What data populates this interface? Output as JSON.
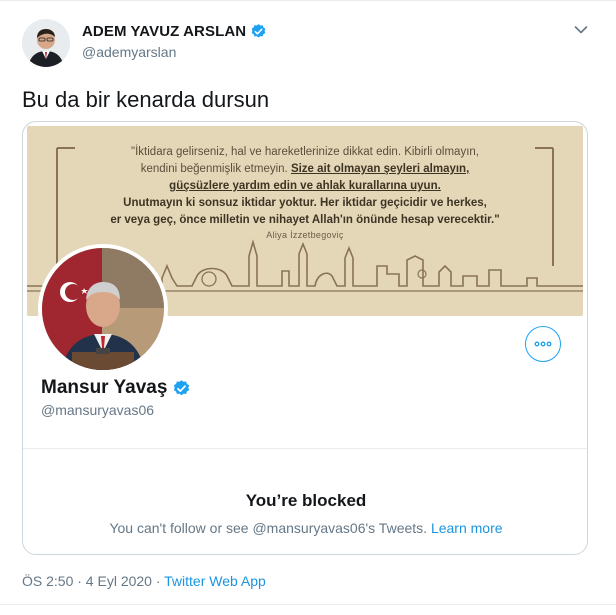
{
  "author": {
    "name": "ADEM YAVUZ ARSLAN",
    "handle": "@ademyarslan",
    "verified": true
  },
  "tweet": {
    "text": "Bu da bir kenarda dursun"
  },
  "card": {
    "banner": {
      "quote_line1": "\"İktidara gelirseniz, hal ve hareketlerinize dikkat edin. Kibirli olmayın,",
      "quote_line2a": "kendini beğenmişlik etmeyin. ",
      "quote_line2b": "Size ait olmayan şeyleri almayın,",
      "quote_line3": "güçsüzlere yardım edin ve ahlak kurallarına uyun.",
      "quote_line4": "Unutmayın ki sonsuz iktidar yoktur. Her iktidar geçicidir ve herkes,",
      "quote_line5": "er veya geç, önce milletin ve nihayet Allah'ın önünde hesap verecektir.\"",
      "attribution": "Aliya İzzetbegoviç"
    },
    "profile": {
      "name": "Mansur Yavaş",
      "handle": "@mansuryavas06",
      "verified": true
    },
    "blocked": {
      "title": "You’re blocked",
      "message": "You can't follow or see @mansuryavas06's Tweets.",
      "link": "Learn more"
    }
  },
  "meta": {
    "time_date": "ÖS 2:50 · 4 Eyl 2020 · ",
    "source": "Twitter Web App"
  },
  "colors": {
    "accent": "#1da1f2",
    "link": "#1b95e0",
    "secondary_text": "#657786",
    "border": "#ccd6dd",
    "banner_bg": "#e9dcc0"
  },
  "icons": {
    "verified": "verified-badge-icon",
    "caret": "chevron-down-icon",
    "more": "more-options-icon"
  }
}
